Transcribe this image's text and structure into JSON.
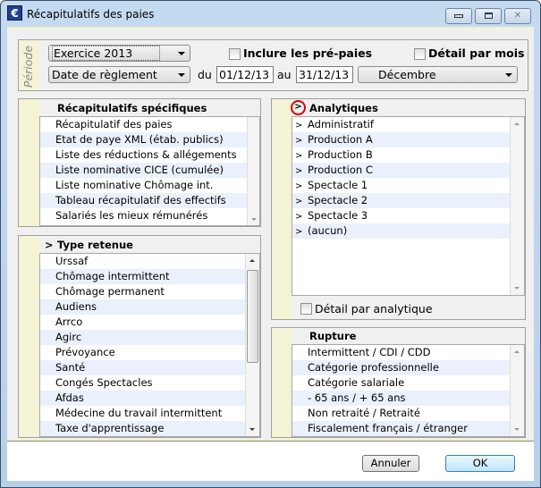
{
  "window": {
    "title": "Récapitulatifs des paies",
    "minimize": "▭",
    "maximize": "□",
    "close": "✕",
    "app_icon": "€"
  },
  "periode": {
    "label": "Période",
    "exercice": "Exercice 2013",
    "date_type": "Date de règlement",
    "du_label": "du",
    "du_value": "01/12/13",
    "au_label": "au",
    "au_value": "31/12/13",
    "mois": "Décembre",
    "inclure_prepaies": "Inclure les pré-paies",
    "detail_par_mois": "Détail par mois"
  },
  "recap": {
    "header": "Récapitulatifs spécifiques",
    "items": [
      "Récapitulatif des paies",
      "Etat de paye XML (étab. publics)",
      "Liste des réductions & allégements",
      "Liste nominative CICE (cumulée)",
      "Liste nominative Chômage int.",
      "Tableau récapitulatif des effectifs",
      "Salariés les mieux rémunérés"
    ]
  },
  "type_retenue": {
    "header": "Type retenue",
    "expander": ">",
    "items": [
      "Urssaf",
      "Chômage intermittent",
      "Chômage permanent",
      "Audiens",
      "Arrco",
      "Agirc",
      "Prévoyance",
      "Santé",
      "Congés Spectacles",
      "Afdas",
      "Médecine du travail intermittent",
      "Taxe d'apprentissage"
    ]
  },
  "analytiques": {
    "header": "Analytiques",
    "expander": ">",
    "items": [
      "Administratif",
      "Production A",
      "Production B",
      "Production C",
      "Spectacle 1",
      "Spectacle 2",
      "Spectacle 3",
      "(aucun)"
    ],
    "detail_checkbox": "Détail par analytique",
    "highlight_color": "#e00000"
  },
  "rupture": {
    "header": "Rupture",
    "items": [
      "Intermittent / CDI / CDD",
      "Catégorie professionnelle",
      "Catégorie salariale",
      "- 65 ans / + 65 ans",
      "Non retraité / Retraité",
      "Fiscalement français / étranger"
    ]
  },
  "buttons": {
    "cancel": "Annuler",
    "ok": "OK"
  }
}
